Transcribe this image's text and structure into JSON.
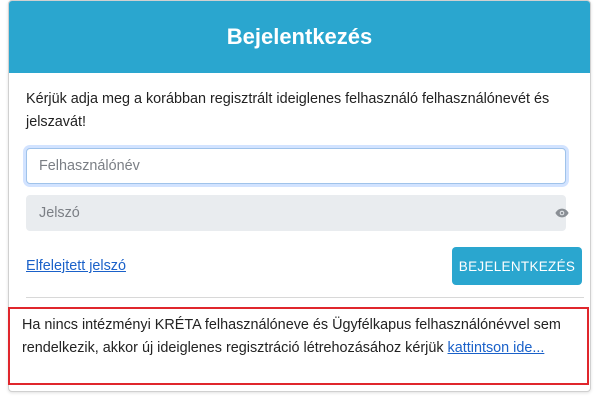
{
  "header": {
    "title": "Bejelentkezés"
  },
  "intro_text": "Kérjük adja meg a korábban regisztrált ideiglenes felhasználó felhasználónevét és jelszavát!",
  "username": {
    "placeholder": "Felhasználónév",
    "value": ""
  },
  "password": {
    "placeholder": "Jelszó",
    "value": "",
    "toggle_icon": "eye-icon"
  },
  "forgot_link": "Elfelejtett jelszó",
  "login_button": "BEJELENTKEZÉS",
  "notice": {
    "text": "Ha nincs intézményi KRÉTA felhasználóneve és Ügyfélkapus felhasználónévvel sem rendelkezik, akkor új ideiglenes regisztráció létrehozásához kérjük ",
    "link": "kattintson ide..."
  },
  "colors": {
    "accent": "#2aa6cf",
    "link": "#1a61c9",
    "notice_border": "#e0262c"
  }
}
